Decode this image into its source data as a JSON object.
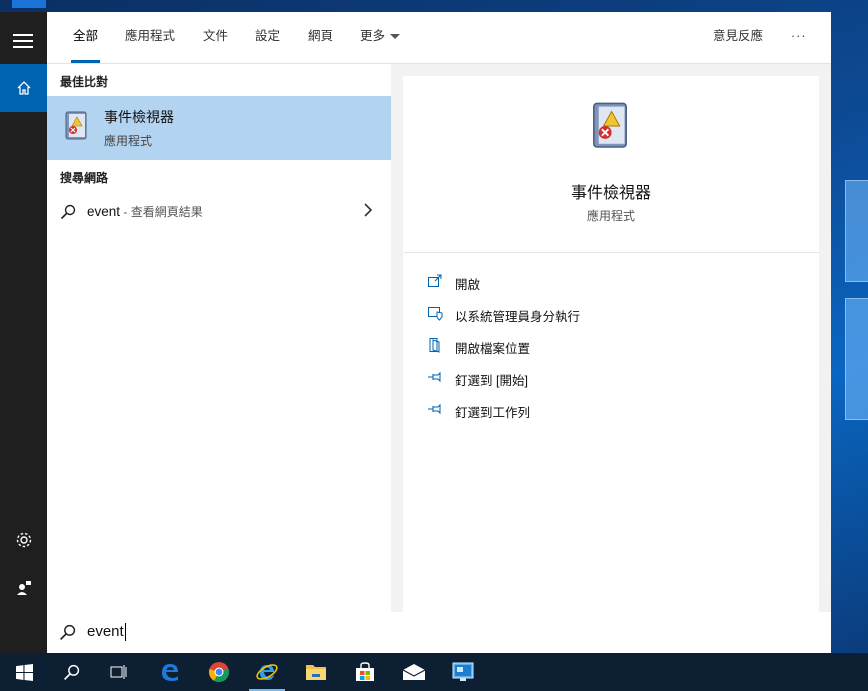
{
  "tabs": [
    {
      "label": "全部",
      "active": true
    },
    {
      "label": "應用程式"
    },
    {
      "label": "文件"
    },
    {
      "label": "設定"
    },
    {
      "label": "網頁"
    },
    {
      "label": "更多"
    }
  ],
  "feedback_label": "意見反應",
  "more_options_label": "···",
  "best_match": {
    "section_label": "最佳比對",
    "title": "事件檢視器",
    "subtitle": "應用程式"
  },
  "web_search": {
    "section_label": "搜尋網路",
    "term": "event",
    "hint": " - 查看網頁結果"
  },
  "preview": {
    "title": "事件檢視器",
    "subtitle": "應用程式",
    "actions": [
      {
        "label": "開啟",
        "icon": "open-icon"
      },
      {
        "label": "以系統管理員身分執行",
        "icon": "shield-icon"
      },
      {
        "label": "開啟檔案位置",
        "icon": "folder-location-icon"
      },
      {
        "label": "釘選到 [開始]",
        "icon": "pin-icon"
      },
      {
        "label": "釘選到工作列",
        "icon": "pin-icon"
      }
    ]
  },
  "search": {
    "query": "event"
  },
  "colors": {
    "accent": "#0063b1",
    "selection": "#b3d4f0",
    "rail": "#1f1f1f",
    "taskbar": "#0d1f33"
  }
}
